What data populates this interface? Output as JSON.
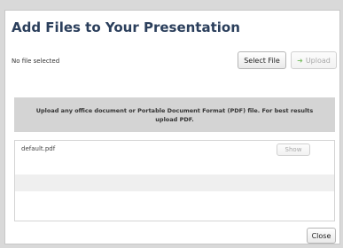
{
  "dialog": {
    "title": "Add Files to Your Presentation",
    "status_text": "No file selected",
    "select_file_label": "Select File",
    "upload_label": "Upload",
    "info_text": "Upload any office document or Portable Document Format (PDF) file.  For best results upload PDF.",
    "files": [
      {
        "name": "default.pdf",
        "action_label": "Show"
      }
    ],
    "close_label": "Close"
  },
  "colors": {
    "title": "#2b3f5c",
    "info_band": "#d4d4d4",
    "upload_arrow": "#7fbf6a",
    "page_background": "#d9d9d9"
  },
  "icons": {
    "upload": "arrow-right-icon"
  }
}
